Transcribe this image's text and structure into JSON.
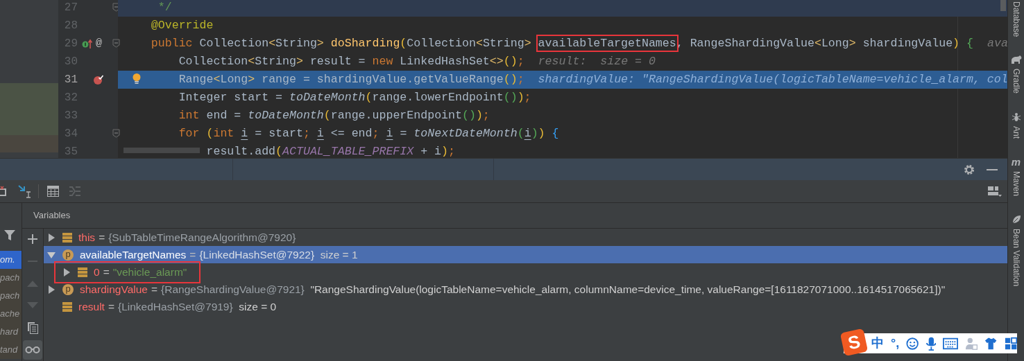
{
  "editor": {
    "lines": [
      {
        "number": "27",
        "caret_line": true,
        "execution_point": false,
        "fold": true,
        "intention": false,
        "segments": [
          {
            "kind": "comment",
            "text": "     */"
          }
        ]
      },
      {
        "number": "28",
        "caret_line": false,
        "execution_point": false,
        "fold": false,
        "intention": false,
        "segments": [
          {
            "kind": "annotation",
            "text": "    @Override"
          }
        ]
      },
      {
        "number": "29",
        "caret_line": false,
        "execution_point": false,
        "fold": true,
        "intention": false,
        "markers": [
          {
            "kind": "override"
          },
          {
            "kind": "text",
            "text": "@"
          }
        ],
        "segments": [
          {
            "kind": "keyword",
            "text": "    public"
          },
          {
            "kind": "plain",
            "text": " Collection"
          },
          {
            "kind": "angle",
            "text": "<"
          },
          {
            "kind": "plain",
            "text": "String"
          },
          {
            "kind": "angle",
            "text": ">"
          },
          {
            "kind": "method",
            "text": " doSharding"
          },
          {
            "kind": "paren",
            "text": "("
          },
          {
            "kind": "plain",
            "text": "Collection"
          },
          {
            "kind": "angle",
            "text": "<"
          },
          {
            "kind": "plain",
            "text": "String"
          },
          {
            "kind": "angle",
            "text": "> "
          },
          {
            "kind": "boxed",
            "text": "availableTargetNames"
          },
          {
            "kind": "plain",
            "text": ", RangeShardingValue"
          },
          {
            "kind": "angle",
            "text": "<"
          },
          {
            "kind": "plain",
            "text": "Long"
          },
          {
            "kind": "angle",
            "text": ">"
          },
          {
            "kind": "plain",
            "text": " shardingValue"
          },
          {
            "kind": "paren",
            "text": ")"
          },
          {
            "kind": "brace",
            "text": " {"
          }
        ],
        "hint": "ava"
      },
      {
        "number": "30",
        "caret_line": false,
        "execution_point": false,
        "fold": false,
        "intention": false,
        "segments": [
          {
            "kind": "plain",
            "text": "        Collection"
          },
          {
            "kind": "angle",
            "text": "<"
          },
          {
            "kind": "plain",
            "text": "String"
          },
          {
            "kind": "angle",
            "text": ">"
          },
          {
            "kind": "plain",
            "text": " result = "
          },
          {
            "kind": "keyword",
            "text": "new"
          },
          {
            "kind": "plain",
            "text": " LinkedHashSet"
          },
          {
            "kind": "angle",
            "text": "<>"
          },
          {
            "kind": "paren",
            "text": "()"
          },
          {
            "kind": "keyword",
            "text": ";"
          }
        ],
        "hint": "result:  size = 0"
      },
      {
        "number": "31",
        "caret_line": false,
        "execution_point": true,
        "fold": false,
        "intention": true,
        "markers": [
          {
            "kind": "breakpoint"
          }
        ],
        "segments": [
          {
            "kind": "plain",
            "text": "        Range"
          },
          {
            "kind": "angle",
            "text": "<"
          },
          {
            "kind": "plain",
            "text": "Long"
          },
          {
            "kind": "angle",
            "text": ">"
          },
          {
            "kind": "plain",
            "text": " range = shardingValue.getValueRange"
          },
          {
            "kind": "paren",
            "text": "()"
          },
          {
            "kind": "keyword",
            "text": ";"
          }
        ],
        "hint": "shardingValue: \"RangeShardingValue(logicTableName=vehicle_alarm, col"
      },
      {
        "number": "32",
        "caret_line": false,
        "execution_point": false,
        "fold": false,
        "intention": false,
        "segments": [
          {
            "kind": "plain",
            "text": "        Integer start = "
          },
          {
            "kind": "static_call",
            "text": "toDateMonth"
          },
          {
            "kind": "paren",
            "text": "("
          },
          {
            "kind": "plain",
            "text": "range.lowerEndpoint"
          },
          {
            "kind": "paren2",
            "text": "()"
          },
          {
            "kind": "paren",
            "text": ")"
          },
          {
            "kind": "keyword",
            "text": ";"
          }
        ]
      },
      {
        "number": "33",
        "caret_line": false,
        "execution_point": false,
        "fold": false,
        "intention": false,
        "segments": [
          {
            "kind": "keyword",
            "text": "        int"
          },
          {
            "kind": "plain",
            "text": " end = "
          },
          {
            "kind": "static_call",
            "text": "toDateMonth"
          },
          {
            "kind": "paren",
            "text": "("
          },
          {
            "kind": "plain",
            "text": "range.upperEndpoint"
          },
          {
            "kind": "paren2",
            "text": "()"
          },
          {
            "kind": "paren",
            "text": ")"
          },
          {
            "kind": "keyword",
            "text": ";"
          }
        ]
      },
      {
        "number": "34",
        "caret_line": false,
        "execution_point": false,
        "fold": true,
        "intention": false,
        "segments": [
          {
            "kind": "keyword",
            "text": "        for"
          },
          {
            "kind": "paren",
            "text": " ("
          },
          {
            "kind": "keyword",
            "text": "int "
          },
          {
            "kind": "underlined",
            "text": "i"
          },
          {
            "kind": "plain",
            "text": " = start"
          },
          {
            "kind": "keyword",
            "text": "; "
          },
          {
            "kind": "underlined",
            "text": "i"
          },
          {
            "kind": "plain",
            "text": " <= end"
          },
          {
            "kind": "keyword",
            "text": "; "
          },
          {
            "kind": "underlined",
            "text": "i"
          },
          {
            "kind": "plain",
            "text": " = "
          },
          {
            "kind": "static_call",
            "text": "toNextDateMonth"
          },
          {
            "kind": "paren2",
            "text": "("
          },
          {
            "kind": "underlined",
            "text": "i"
          },
          {
            "kind": "paren2",
            "text": ")"
          },
          {
            "kind": "paren",
            "text": ")"
          },
          {
            "kind": "brace2",
            "text": " {"
          }
        ]
      },
      {
        "number": "35",
        "caret_line": false,
        "execution_point": false,
        "fold": false,
        "intention": false,
        "segments": [
          {
            "kind": "plain",
            "text": "            result.add"
          },
          {
            "kind": "paren",
            "text": "("
          },
          {
            "kind": "constant",
            "text": "ACTUAL_TABLE_PREFIX"
          },
          {
            "kind": "plain",
            "text": " + i"
          },
          {
            "kind": "paren",
            "text": ")"
          },
          {
            "kind": "keyword",
            "text": ";"
          }
        ]
      }
    ]
  },
  "frames": [
    {
      "text": "om.",
      "selected": true
    },
    {
      "text": "pach",
      "selected": false
    },
    {
      "text": "pach",
      "selected": false
    },
    {
      "text": "ache",
      "selected": false
    },
    {
      "text": "hard",
      "selected": false
    },
    {
      "text": "tand",
      "selected": false
    }
  ],
  "variable_actions": [
    {
      "kind": "add",
      "disabled": false,
      "selected": false
    },
    {
      "kind": "remove",
      "disabled": true,
      "selected": false
    },
    {
      "kind": "up",
      "disabled": true,
      "selected": false
    },
    {
      "kind": "down",
      "disabled": true,
      "selected": false
    },
    {
      "kind": "copy",
      "disabled": false,
      "selected": false
    },
    {
      "kind": "watches",
      "disabled": false,
      "selected": true
    }
  ],
  "variables": {
    "title": "Variables",
    "items": [
      {
        "name": "this",
        "operator": "=",
        "ref": "{SubTableTimeRangeAlgorithm@7920}",
        "kind": "field",
        "expandable": true,
        "expanded": false,
        "selected": false,
        "annotated": false
      },
      {
        "name": "availableTargetNames",
        "operator": "=",
        "ref": "{LinkedHashSet@7922}",
        "extra": "size = 1",
        "kind": "parameter",
        "badge": "p",
        "expandable": true,
        "expanded": true,
        "selected": true,
        "annotated": false,
        "children": [
          {
            "name": "0",
            "operator": "=",
            "string": "\"vehicle_alarm\"",
            "kind": "field",
            "expandable": true,
            "expanded": false,
            "selected": false,
            "annotated": true
          }
        ]
      },
      {
        "name": "shardingValue",
        "operator": "=",
        "ref": "{RangeShardingValue@7921}",
        "extra": "\"RangeShardingValue(logicTableName=vehicle_alarm, columnName=device_time, valueRange=[1611827071000..1614517065621])\"",
        "kind": "parameter",
        "badge": "p",
        "expandable": true,
        "expanded": false,
        "selected": false,
        "annotated": false
      },
      {
        "name": "result",
        "operator": "=",
        "ref": "{LinkedHashSet@7919}",
        "extra": "size = 0",
        "kind": "field",
        "expandable": false,
        "selected": false,
        "annotated": false
      }
    ]
  },
  "tool_windows": [
    {
      "label": "Database",
      "kind": "none"
    },
    {
      "label": "Gradle",
      "kind": "gradle"
    },
    {
      "label": "Ant",
      "kind": "ant"
    },
    {
      "label": "Maven",
      "kind": "maven",
      "icon_text": "m"
    },
    {
      "label": "Bean Validation",
      "kind": "bean"
    }
  ],
  "ime": {
    "logo": "S",
    "mode": "中",
    "punctuation": "°,"
  }
}
